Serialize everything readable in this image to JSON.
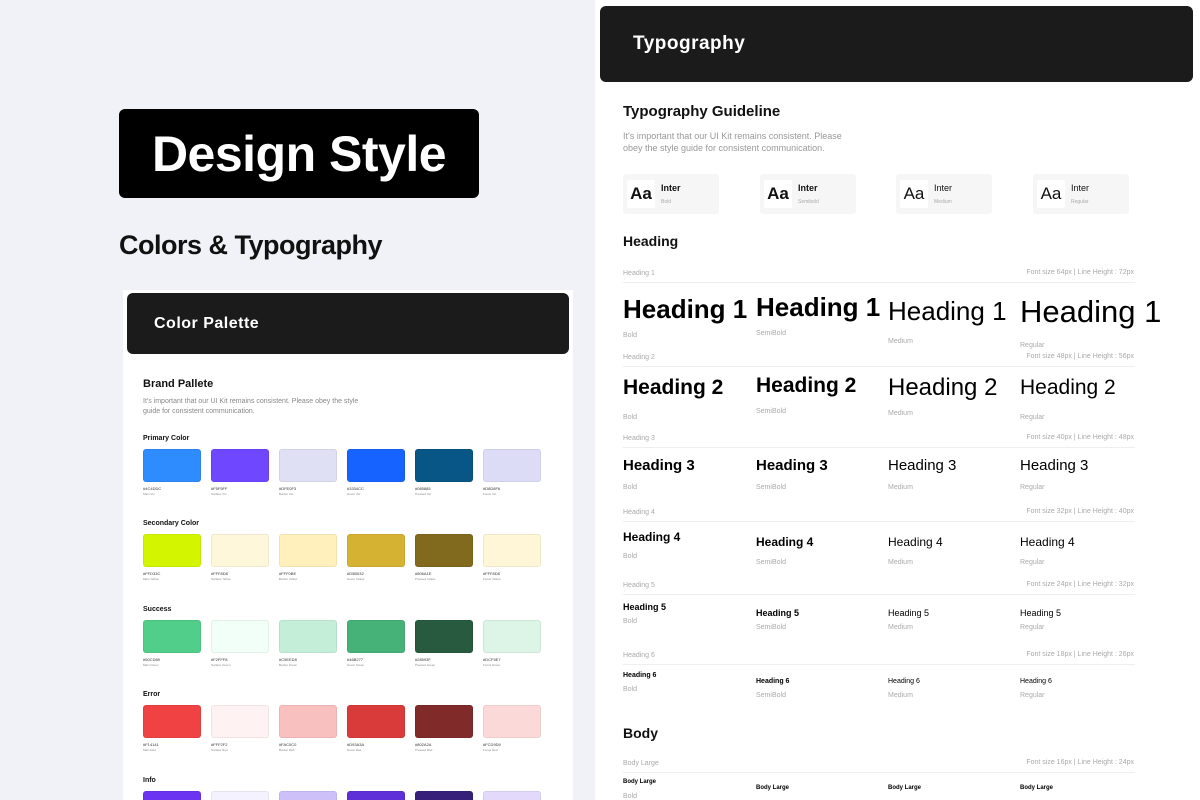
{
  "title": "Design Style",
  "subtitle": "Colors & Typography",
  "palette": {
    "header": "Color Palette",
    "brand_title": "Brand Pallete",
    "brand_desc": "It's important that our UI Kit remains consistent. Please obey the style guide for consistent communication.",
    "groups": [
      {
        "label": "Primary Color",
        "swatches": [
          {
            "hex": "#4C4DDC",
            "name": "Main Vio",
            "color": "#2f8cff"
          },
          {
            "hex": "#F5F5FF",
            "name": "Surface Vio",
            "color": "#6e47ff"
          },
          {
            "hex": "#DFE0F3",
            "name": "Border Vio",
            "color": "#dfe0f3"
          },
          {
            "hex": "#3334CC",
            "name": "Hover Vio",
            "color": "#1663ff"
          },
          {
            "hex": "#085885",
            "name": "Pressed Vio",
            "color": "#075685"
          },
          {
            "hex": "#D8D8F6",
            "name": "Focus Vio",
            "color": "#dcdcf6"
          }
        ]
      },
      {
        "label": "Secondary Color",
        "swatches": [
          {
            "hex": "#FFD33C",
            "name": "Main Yellow",
            "color": "#d3f600"
          },
          {
            "hex": "#FFF8D8",
            "name": "Surface Yellow",
            "color": "#fff7d9"
          },
          {
            "hex": "#FFF0BE",
            "name": "Border Yellow",
            "color": "#fff0bc"
          },
          {
            "hex": "#D5B032",
            "name": "Hover Yellow",
            "color": "#d6b233"
          },
          {
            "hex": "#806A1E",
            "name": "Pressed Yellow",
            "color": "#816a1e"
          },
          {
            "hex": "#FFF8D8",
            "name": "Focus Yellow",
            "color": "#fff6d8"
          }
        ]
      },
      {
        "label": "Success",
        "swatches": [
          {
            "hex": "#50CD89",
            "name": "Main Green",
            "color": "#51cf8a"
          },
          {
            "hex": "#F2FFF8",
            "name": "Surface Green",
            "color": "#f2fff8"
          },
          {
            "hex": "#C5EED8",
            "name": "Border Green",
            "color": "#c5eed9"
          },
          {
            "hex": "#46B277",
            "name": "Hover Green",
            "color": "#46b277"
          },
          {
            "hex": "#28593F",
            "name": "Pressed Green",
            "color": "#285a40"
          },
          {
            "hex": "#DCF5E7",
            "name": "Focus Green",
            "color": "#dcf5e7"
          }
        ]
      },
      {
        "label": "Error",
        "swatches": [
          {
            "hex": "#F14141",
            "name": "Main Red",
            "color": "#f04242"
          },
          {
            "hex": "#FFF2F2",
            "name": "Surface Red",
            "color": "#fff2f2"
          },
          {
            "hex": "#FAC0C0",
            "name": "Border Red",
            "color": "#f9c0c0"
          },
          {
            "hex": "#D93A3A",
            "name": "Hover Red",
            "color": "#d93a3a"
          },
          {
            "hex": "#802A2A",
            "name": "Pressed Red",
            "color": "#802a2a"
          },
          {
            "hex": "#FCD9D9",
            "name": "Focus Red",
            "color": "#fcd9d9"
          }
        ]
      },
      {
        "label": "Info",
        "swatches": [
          {
            "hex": "",
            "name": "",
            "color": "#6b34f0"
          },
          {
            "hex": "",
            "name": "",
            "color": "#f5f2ff"
          },
          {
            "hex": "",
            "name": "",
            "color": "#cdbff8"
          },
          {
            "hex": "",
            "name": "",
            "color": "#5f2fd8"
          },
          {
            "hex": "",
            "name": "",
            "color": "#36207a"
          },
          {
            "hex": "",
            "name": "",
            "color": "#e2d9fb"
          }
        ]
      }
    ]
  },
  "typography": {
    "header": "Typography",
    "guide_title": "Typography Guideline",
    "guide_desc": "It's important that our UI Kit remains consistent. Please obey the style guide for consistent communication.",
    "fonts": [
      {
        "aa": "Aa",
        "name": "Inter",
        "weight": "Bold"
      },
      {
        "aa": "Aa",
        "name": "Inter",
        "weight": "Semibold"
      },
      {
        "aa": "Aa",
        "name": "Inter",
        "weight": "Medium"
      },
      {
        "aa": "Aa",
        "name": "Inter",
        "weight": "Regular"
      }
    ],
    "heading_section": "Heading",
    "headings": [
      {
        "label": "Heading 1",
        "meta": "Font size 64px | Line Height : 72px",
        "sample": "Heading 1",
        "weights": [
          "Bold",
          "SemiBold",
          "Medium",
          "Regular"
        ]
      },
      {
        "label": "Heading 2",
        "meta": "Font size 48px | Line Height : 56px",
        "sample": "Heading 2",
        "weights": [
          "Bold",
          "SemiBold",
          "Medium",
          "Regular"
        ]
      },
      {
        "label": "Heading 3",
        "meta": "Font size 40px | Line Height : 48px",
        "sample": "Heading 3",
        "weights": [
          "Bold",
          "SemiBold",
          "Medium",
          "Regular"
        ]
      },
      {
        "label": "Heading 4",
        "meta": "Font size 32px | Line Height : 40px",
        "sample": "Heading 4",
        "weights": [
          "Bold",
          "SemiBold",
          "Medium",
          "Regular"
        ]
      },
      {
        "label": "Heading 5",
        "meta": "Font size 24px | Line Height : 32px",
        "sample": "Heading 5",
        "weights": [
          "Bold",
          "SemiBold",
          "Medium",
          "Regular"
        ]
      },
      {
        "label": "Heading 6",
        "meta": "Font size 18px | Line Height : 26px",
        "sample": "Heading 6",
        "weights": [
          "Bold",
          "SemiBold",
          "Medium",
          "Regular"
        ]
      }
    ],
    "body_section": "Body",
    "body": [
      {
        "label": "Body Large",
        "meta": "Font size 16px | Line Height : 24px",
        "sample": "Body Large",
        "weights": [
          "Bold"
        ]
      }
    ]
  }
}
